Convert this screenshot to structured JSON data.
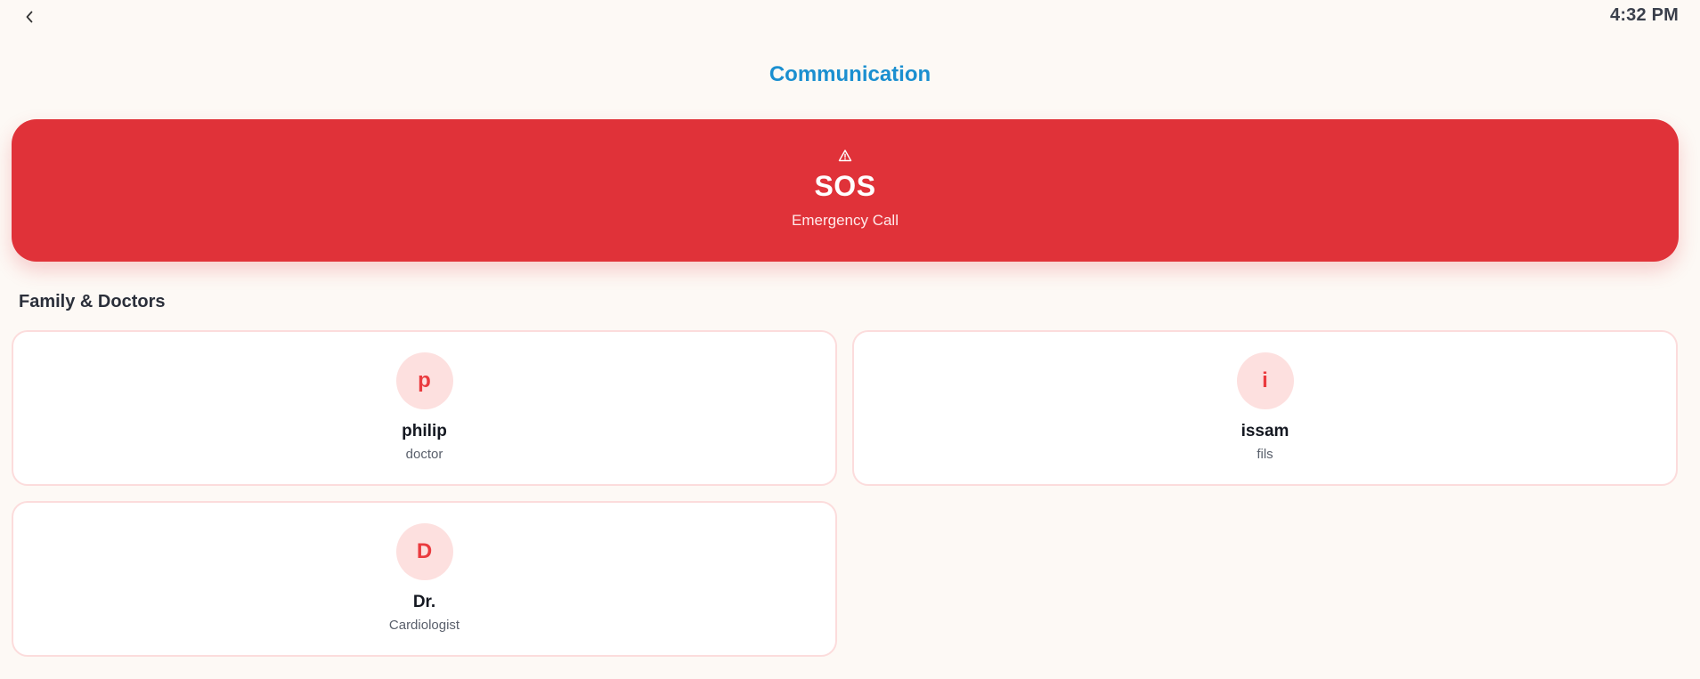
{
  "status_bar": {
    "time": "4:32 PM"
  },
  "header": {
    "back_icon": "chevron-left-icon",
    "title": "Communication"
  },
  "sos": {
    "icon": "warning-triangle-icon",
    "label": "SOS",
    "subtitle": "Emergency Call"
  },
  "contacts_section": {
    "title": "Family & Doctors",
    "contacts": [
      {
        "initial": "p",
        "name": "philip",
        "role": "doctor"
      },
      {
        "initial": "i",
        "name": "issam",
        "role": "fils"
      },
      {
        "initial": "D",
        "name": "Dr.",
        "role": "Cardiologist"
      }
    ]
  },
  "colors": {
    "background": "#fdf9f5",
    "title_blue": "#1b8fd0",
    "sos_red": "#e03239",
    "avatar_bg": "#fde0df",
    "avatar_text": "#ea3b3f",
    "card_border": "#fcdcdc"
  }
}
